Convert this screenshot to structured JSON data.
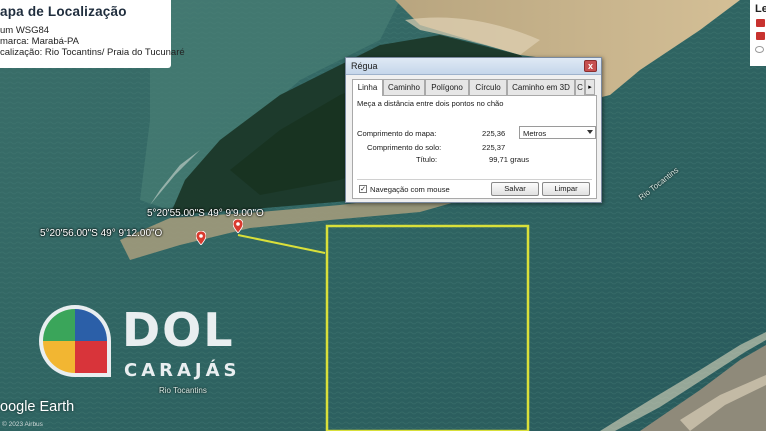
{
  "legend": {
    "title": "apa de Localização",
    "datum": "um WSG84",
    "comarca": "marca: Marabá-PA",
    "localizacao": "calização: Rio Tocantins/ Praia do Tucunaré",
    "right_title": "Le"
  },
  "map": {
    "pin1_label": "5°20'55.00\"S  49° 9'9.00\"O",
    "pin2_label": "5°20'56.00\"S  49° 9'12.00\"O",
    "river_label_1": "Rio Tocantins",
    "river_label_2": "Rio Tocantins",
    "colors": {
      "water": "#2f6462",
      "forest": "#1d3a2c",
      "sand": "#c9b48c",
      "highlight": "#d9e03a",
      "pin": "#d93a2e"
    }
  },
  "dialog": {
    "title": "Régua",
    "close_label": "x",
    "tabs": [
      "Linha",
      "Caminho",
      "Polígono",
      "Círculo",
      "Caminho em 3D",
      "C"
    ],
    "active_tab": "Linha",
    "tab_scroll_glyph": "▸",
    "instruction": "Meça a distância entre dois pontos no chão",
    "map_length_label": "Comprimento do mapa:",
    "map_length_value": "225,36",
    "unit_selected": "Metros",
    "ground_length_label": "Comprimento do solo:",
    "ground_length_value": "225,37",
    "heading_label": "Título:",
    "heading_value": "99,71 graus",
    "mouse_nav_label": "Navegação com mouse",
    "mouse_nav_checked": "✓",
    "save_label": "Salvar",
    "clear_label": "Limpar"
  },
  "watermark": {
    "brand": "DOL",
    "sub": "CARAJÁS",
    "google_earth": "oogle Earth",
    "copyright": "© 2023 Airbus"
  }
}
